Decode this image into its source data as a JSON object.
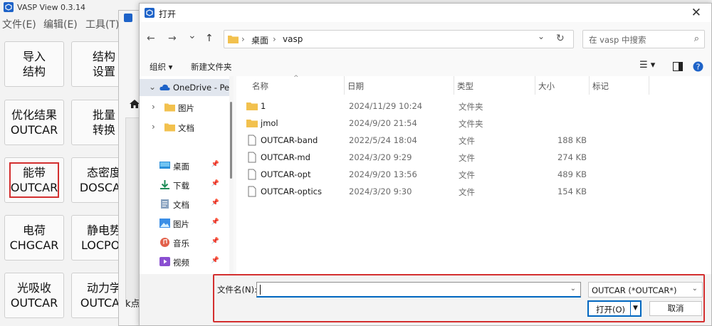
{
  "main_app": {
    "title": "VASP View 0.3.14",
    "menu": [
      "文件(E)",
      "编辑(E)",
      "工具(T)"
    ],
    "buttons": [
      {
        "line1": "导入",
        "line2": "结构"
      },
      {
        "line1": "结构",
        "line2": "设置"
      },
      {
        "line1": "优化结果",
        "line2": "OUTCAR"
      },
      {
        "line1": "批量",
        "line2": "转换"
      },
      {
        "line1": "能带",
        "line2": "OUTCAR"
      },
      {
        "line1": "态密度",
        "line2": "DOSCAR"
      },
      {
        "line1": "电荷",
        "line2": "CHGCAR"
      },
      {
        "line1": "静电势",
        "line2": "LOCPOT"
      },
      {
        "line1": "光吸收",
        "line2": "OUTCAR"
      },
      {
        "line1": "动力学",
        "line2": "OUTCAR"
      }
    ],
    "kpoint_text": "k点",
    "highlight_color": "#d32f2f"
  },
  "dialog": {
    "title": "打开",
    "close": "✕",
    "nav": {
      "back": "←",
      "forward": "→",
      "recent": "⌄",
      "up": "↑"
    },
    "address": {
      "part1": "桌面",
      "sep": "›",
      "part2": "vasp",
      "dropdown": "⌄",
      "refresh": "↻"
    },
    "search_placeholder": "在 vasp 中搜索",
    "toolbar": {
      "organize": "组织 ▾",
      "new_folder": "新建文件夹",
      "view": "☰ ▾"
    },
    "navpane": [
      {
        "label": "OneDrive - Per",
        "icon": "cloud-icon",
        "chevron": "⌄"
      },
      {
        "label": "图片",
        "icon": "folder-icon",
        "chevron": "›"
      },
      {
        "label": "文档",
        "icon": "folder-icon",
        "chevron": "›"
      },
      {
        "label": "桌面",
        "icon": "desktop-icon",
        "pin": "📌"
      },
      {
        "label": "下载",
        "icon": "download-icon",
        "pin": "📌"
      },
      {
        "label": "文档",
        "icon": "document-icon",
        "pin": "📌"
      },
      {
        "label": "图片",
        "icon": "picture-icon",
        "pin": "📌"
      },
      {
        "label": "音乐",
        "icon": "music-icon",
        "pin": "📌"
      },
      {
        "label": "视频",
        "icon": "video-icon",
        "pin": "📌"
      }
    ],
    "columns": {
      "name": "名称",
      "date": "日期",
      "type": "类型",
      "size": "大小",
      "tags": "标记"
    },
    "files": [
      {
        "name": "1",
        "date": "2024/11/29 10:24",
        "type": "文件夹",
        "size": "",
        "icon": "folder-icon"
      },
      {
        "name": "jmol",
        "date": "2024/9/20 21:54",
        "type": "文件夹",
        "size": "",
        "icon": "folder-icon"
      },
      {
        "name": "OUTCAR-band",
        "date": "2022/5/24 18:04",
        "type": "文件",
        "size": "188 KB",
        "icon": "file-icon"
      },
      {
        "name": "OUTCAR-md",
        "date": "2024/3/20 9:29",
        "type": "文件",
        "size": "274 KB",
        "icon": "file-icon"
      },
      {
        "name": "OUTCAR-opt",
        "date": "2024/9/20 13:56",
        "type": "文件",
        "size": "489 KB",
        "icon": "file-icon"
      },
      {
        "name": "OUTCAR-optics",
        "date": "2024/3/20 9:30",
        "type": "文件",
        "size": "154 KB",
        "icon": "file-icon"
      }
    ],
    "filename_label": "文件名(N):",
    "filename_value": "",
    "filetype": "OUTCAR (*OUTCAR*)",
    "open_label": "打开(O)",
    "cancel_label": "取消"
  }
}
